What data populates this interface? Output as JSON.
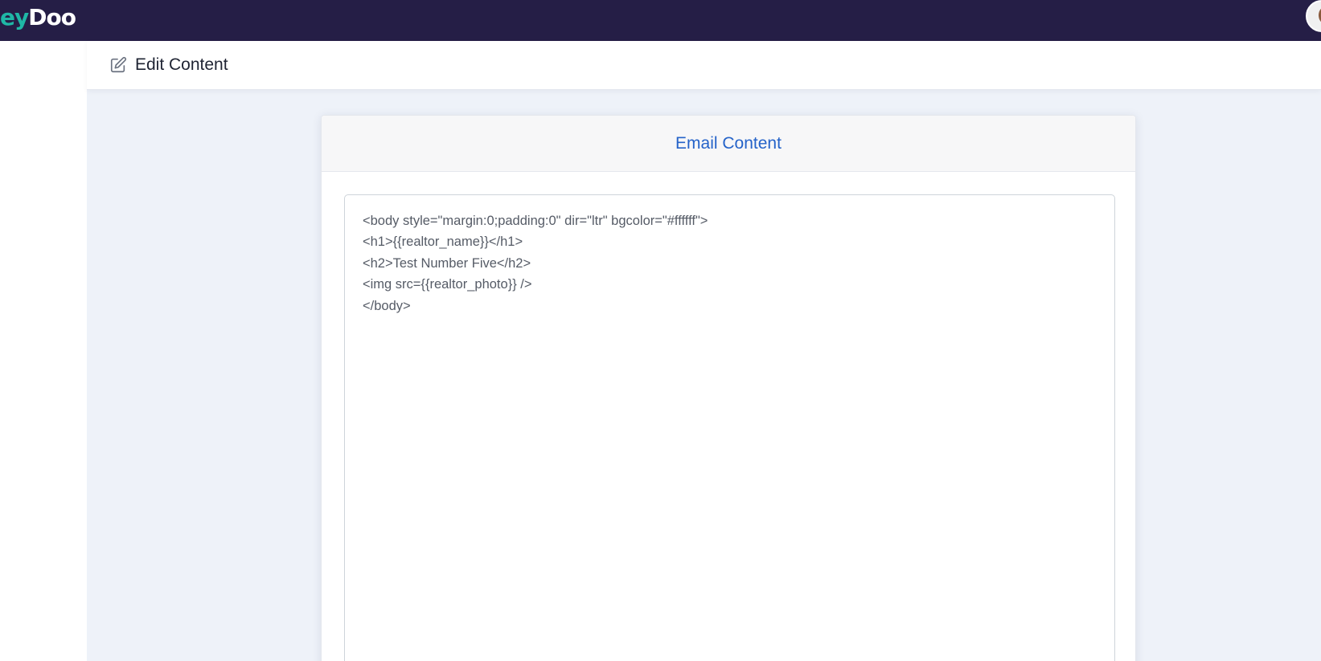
{
  "app": {
    "logo_part_a": "ey",
    "logo_part_b": "Doo",
    "colors": {
      "topbar": "#251e46",
      "logo_accent": "#1fb7a6",
      "title_blue": "#2563c9",
      "content_bg": "#eef2f9"
    }
  },
  "header": {
    "icon": "edit-icon",
    "title": "Edit Content"
  },
  "card": {
    "title": "Email Content",
    "editor_value": "<body style=\"margin:0;padding:0\" dir=\"ltr\" bgcolor=\"#ffffff\">\n<h1>{{realtor_name}}</h1>\n<h2>Test Number Five</h2>\n<img src={{realtor_photo}} />\n</body>"
  },
  "user": {
    "avatar_icon": "user-avatar"
  }
}
